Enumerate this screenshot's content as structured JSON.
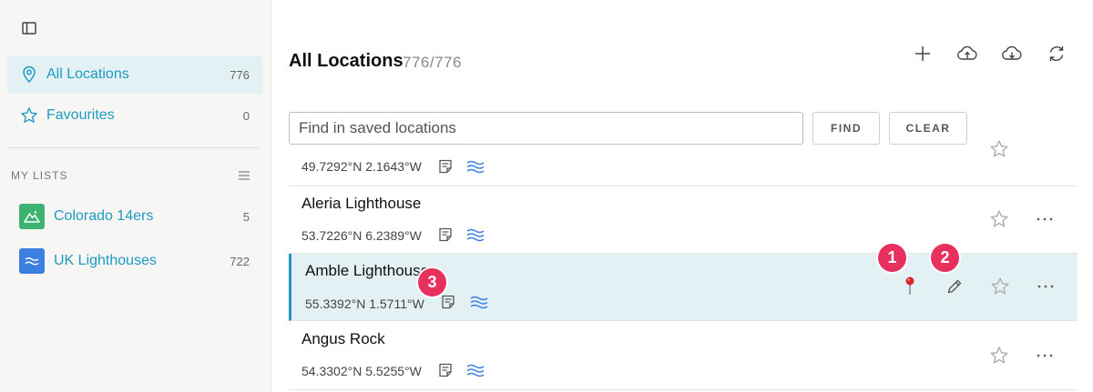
{
  "sidebar": {
    "nav": [
      {
        "label": "All Locations",
        "count": "776"
      },
      {
        "label": "Favourites",
        "count": "0"
      }
    ],
    "section_title": "MY LISTS",
    "lists": [
      {
        "label": "Colorado 14ers",
        "count": "5",
        "color": "#3cb371",
        "icon": "mountain-icon"
      },
      {
        "label": "UK Lighthouses",
        "count": "722",
        "color": "#3d7fe0",
        "icon": "waves-icon"
      }
    ]
  },
  "header": {
    "title": "All Locations",
    "count": "776/776"
  },
  "search": {
    "placeholder": "Find in saved locations",
    "find_label": "FIND",
    "clear_label": "CLEAR"
  },
  "rows": [
    {
      "name": "",
      "coords": "49.7292°N 2.1643°W"
    },
    {
      "name": "Aleria Lighthouse",
      "coords": "53.7226°N 6.2389°W"
    },
    {
      "name": "Amble Lighthouse",
      "coords": "55.3392°N 1.5711°W"
    },
    {
      "name": "Angus Rock",
      "coords": "54.3302°N 5.5255°W"
    }
  ],
  "callouts": [
    "1",
    "2",
    "3"
  ],
  "colors": {
    "accent": "#1e9bc0",
    "highlight_bg": "#e3f1f5",
    "callout": "#e8305f"
  }
}
